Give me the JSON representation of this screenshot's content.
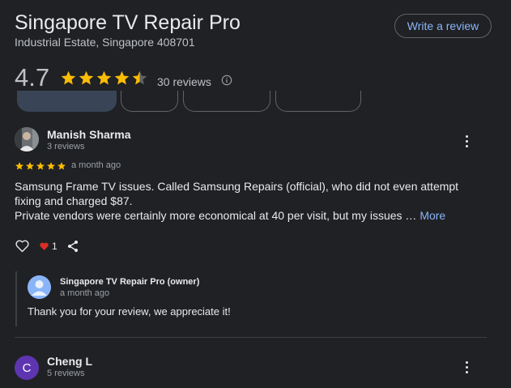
{
  "business": {
    "name": "Singapore TV Repair Pro",
    "address": "Industrial Estate, Singapore 408701",
    "write_review_label": "Write a review",
    "rating": "4.7",
    "rating_value": 4.7,
    "reviews_count": "30 reviews"
  },
  "colors": {
    "star": "#fbbc04",
    "link": "#8ab4f8",
    "heart": "#d93025",
    "avatar_purple": "#5e35b1"
  },
  "reviews": [
    {
      "name": "Manish Sharma",
      "meta": "3 reviews",
      "stars": 5,
      "time": "a month ago",
      "text_line1": "Samsung Frame TV issues. Called Samsung Repairs (official), who did not even attempt fixing and charged $87.",
      "text_line2": "Private vendors were certainly more economical at 40 per visit, but my issues …",
      "more": "More",
      "likes": "1",
      "owner_reply": {
        "name": "Singapore TV Repair Pro (owner)",
        "time": "a month ago",
        "text": "Thank you for your review, we appreciate it!"
      }
    },
    {
      "name": "Cheng L",
      "initial": "C",
      "meta": "5 reviews"
    }
  ]
}
